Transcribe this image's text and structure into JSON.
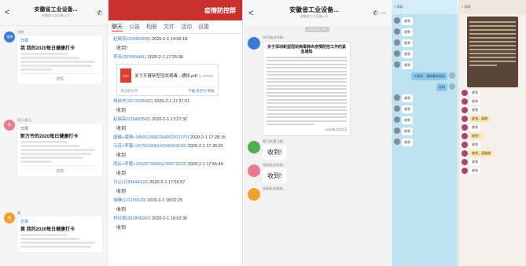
{
  "p1": {
    "back": "<",
    "title": "安徽省工业设备...",
    "subtitle": "安徽省工业设备公司",
    "cards": [
      {
        "avatar": "张博",
        "name": "张博",
        "tag": "日报",
        "title": "我 我的2020每日健康打卡",
        "lines": 4,
        "foot": "详情"
      },
      {
        "avatar": "杨",
        "name": "杨万(杨万)",
        "tag": "日报",
        "title": "新万齐的2020每日健康打卡",
        "lines": 5,
        "foot": "详情"
      },
      {
        "avatar": "黄",
        "name": "黄",
        "tag": "日报",
        "title": "黄 我的2020每日健康打卡",
        "lines": 4,
        "foot": "详情"
      }
    ]
  },
  "p2": {
    "header": "疫情防控群",
    "tabs": [
      "聊天",
      "公告",
      "相册",
      "文件",
      "活动",
      "设置"
    ],
    "items": [
      {
        "u": "赵锡亮(028483565)",
        "t": " 2020-2-1 14:06:18",
        "r": "收到！"
      },
      {
        "u": "李亮(307809481)",
        "t": " 2020-2-1 17:25:38",
        "r": ""
      },
      {
        "u": "胡启东(1072935582)",
        "t": " 2020-2-1 17:27:21",
        "r": "收到"
      },
      {
        "u": "赵锡亮(028483565)",
        "t": " 2020-2-1 17:27:32",
        "r": "收到"
      },
      {
        "u": "唐建+龚晴+18656158823(4062203370)",
        "t": " 2020-2-1 17:28:15",
        "r": ""
      },
      {
        "u": "马苏+李蔓+15755199014(346094183)",
        "t": " 2020-2-1 17:36:35",
        "r": "收到"
      },
      {
        "u": "西云+李蔓+15929738656(245872022)",
        "t": " 2020-2-1 17:56:49",
        "r": "收到"
      },
      {
        "u": "马让(1194844193)",
        "t": " 2020-2-1 17:56:57",
        "r": "收到"
      },
      {
        "u": "瑞琳(121195620)",
        "t": " 2020-2-1 18:02:25",
        "r": "收到"
      },
      {
        "u": "刘红艳(362805067)",
        "t": " 2020-2-1 18:02:36",
        "r": "收到"
      }
    ],
    "file": {
      "name": "关于开展新型冠状病毒...通知.pdf",
      "size": "(1.49MB)",
      "from": "来自群文件",
      "actions": "下载  另存为  转发"
    }
  },
  "p3": {
    "back": "<",
    "title": "安徽省工业设备...",
    "subtitle": "安徽省工业设备公司",
    "date": "1月16日 上午",
    "sender1": "李亮娟(李亮娟)",
    "doc_title": "关于深圳新型冠状病毒肺炎疫情防控工作的紧急通知",
    "doc_sign": "2020年1月31日",
    "sender2": "董玉娟(董玉娟)",
    "reply2": "收到!",
    "sender3": "张柏娜(张柏娜)",
    "reply3": "收到!",
    "sender4": "姚春静(姚春静)"
  },
  "p4": {
    "header": "< 群聊",
    "msgs": [
      {
        "side": "l",
        "text": "收到"
      },
      {
        "side": "l",
        "text": "收到"
      },
      {
        "side": "l",
        "text": "收到"
      },
      {
        "side": "l",
        "text": "收到"
      },
      {
        "side": "l",
        "text": "收到"
      },
      {
        "side": "r",
        "text": "大家好，请按要求报送"
      },
      {
        "side": "r",
        "text": "好的"
      },
      {
        "side": "l",
        "text": "收到"
      },
      {
        "side": "l",
        "text": "收到"
      },
      {
        "side": "l",
        "text": "收到"
      },
      {
        "side": "l",
        "text": "收到"
      },
      {
        "side": "l",
        "text": "收到"
      }
    ]
  },
  "p5": {
    "header": "< 群聊",
    "msgs": [
      {
        "text": "收到",
        "hl": false
      },
      {
        "text": "收到",
        "hl": false
      },
      {
        "text": "收到",
        "hl": false
      },
      {
        "text": "收到，谢谢",
        "hl": true
      },
      {
        "text": "收到",
        "hl": false
      },
      {
        "text": "收到！",
        "hl": true
      },
      {
        "text": "收到",
        "hl": false
      },
      {
        "text": "收到，请谢谢",
        "hl": true
      },
      {
        "text": "收到",
        "hl": false
      },
      {
        "text": "收到",
        "hl": false
      }
    ]
  }
}
